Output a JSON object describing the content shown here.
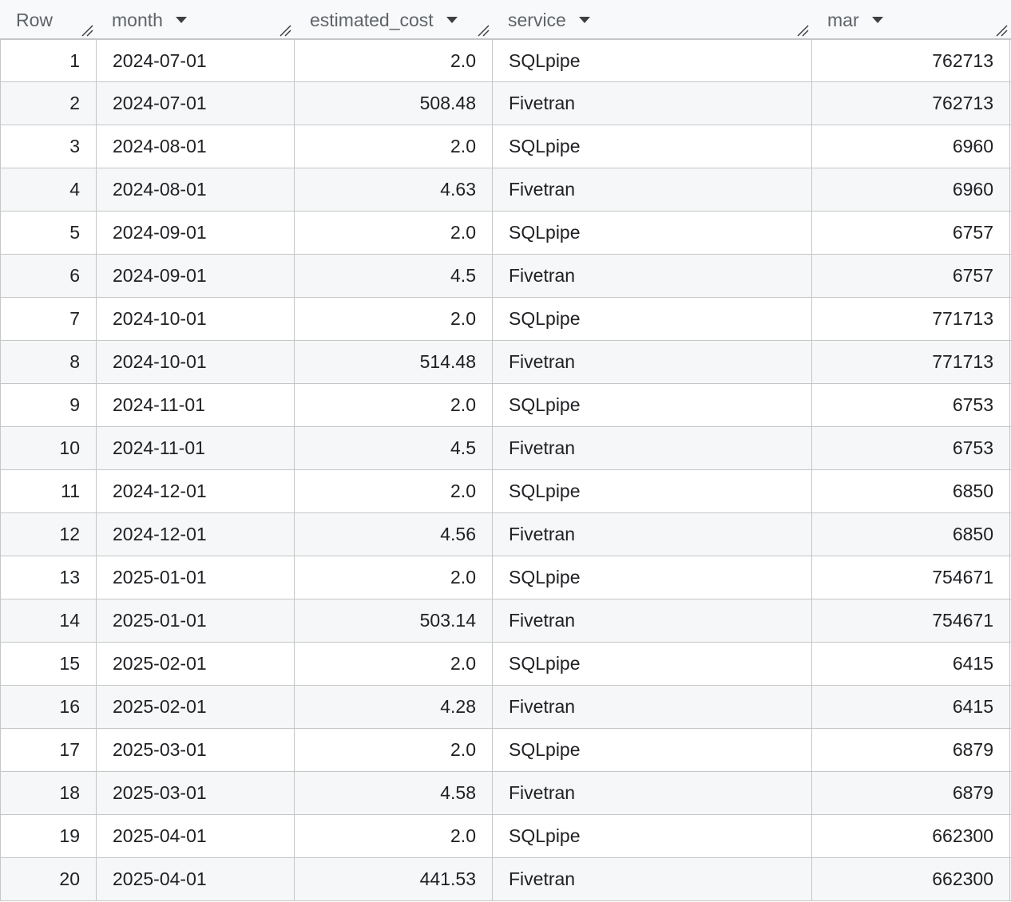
{
  "columns": [
    {
      "label": "Row",
      "has_menu": false
    },
    {
      "label": "month",
      "has_menu": true
    },
    {
      "label": "estimated_cost",
      "has_menu": true
    },
    {
      "label": "service",
      "has_menu": true
    },
    {
      "label": "mar",
      "has_menu": true
    }
  ],
  "rows": [
    {
      "row": "1",
      "month": "2024-07-01",
      "estimated_cost": "2.0",
      "service": "SQLpipe",
      "mar": "762713"
    },
    {
      "row": "2",
      "month": "2024-07-01",
      "estimated_cost": "508.48",
      "service": "Fivetran",
      "mar": "762713"
    },
    {
      "row": "3",
      "month": "2024-08-01",
      "estimated_cost": "2.0",
      "service": "SQLpipe",
      "mar": "6960"
    },
    {
      "row": "4",
      "month": "2024-08-01",
      "estimated_cost": "4.63",
      "service": "Fivetran",
      "mar": "6960"
    },
    {
      "row": "5",
      "month": "2024-09-01",
      "estimated_cost": "2.0",
      "service": "SQLpipe",
      "mar": "6757"
    },
    {
      "row": "6",
      "month": "2024-09-01",
      "estimated_cost": "4.5",
      "service": "Fivetran",
      "mar": "6757"
    },
    {
      "row": "7",
      "month": "2024-10-01",
      "estimated_cost": "2.0",
      "service": "SQLpipe",
      "mar": "771713"
    },
    {
      "row": "8",
      "month": "2024-10-01",
      "estimated_cost": "514.48",
      "service": "Fivetran",
      "mar": "771713"
    },
    {
      "row": "9",
      "month": "2024-11-01",
      "estimated_cost": "2.0",
      "service": "SQLpipe",
      "mar": "6753"
    },
    {
      "row": "10",
      "month": "2024-11-01",
      "estimated_cost": "4.5",
      "service": "Fivetran",
      "mar": "6753"
    },
    {
      "row": "11",
      "month": "2024-12-01",
      "estimated_cost": "2.0",
      "service": "SQLpipe",
      "mar": "6850"
    },
    {
      "row": "12",
      "month": "2024-12-01",
      "estimated_cost": "4.56",
      "service": "Fivetran",
      "mar": "6850"
    },
    {
      "row": "13",
      "month": "2025-01-01",
      "estimated_cost": "2.0",
      "service": "SQLpipe",
      "mar": "754671"
    },
    {
      "row": "14",
      "month": "2025-01-01",
      "estimated_cost": "503.14",
      "service": "Fivetran",
      "mar": "754671"
    },
    {
      "row": "15",
      "month": "2025-02-01",
      "estimated_cost": "2.0",
      "service": "SQLpipe",
      "mar": "6415"
    },
    {
      "row": "16",
      "month": "2025-02-01",
      "estimated_cost": "4.28",
      "service": "Fivetran",
      "mar": "6415"
    },
    {
      "row": "17",
      "month": "2025-03-01",
      "estimated_cost": "2.0",
      "service": "SQLpipe",
      "mar": "6879"
    },
    {
      "row": "18",
      "month": "2025-03-01",
      "estimated_cost": "4.58",
      "service": "Fivetran",
      "mar": "6879"
    },
    {
      "row": "19",
      "month": "2025-04-01",
      "estimated_cost": "2.0",
      "service": "SQLpipe",
      "mar": "662300"
    },
    {
      "row": "20",
      "month": "2025-04-01",
      "estimated_cost": "441.53",
      "service": "Fivetran",
      "mar": "662300"
    }
  ],
  "colors": {
    "header_bg": "#f8f9fa",
    "alt_row_bg": "#f6f7f9",
    "border": "#c4c7c5",
    "text": "#202124",
    "header_text": "#5f6368"
  },
  "icons": {
    "sort_menu": "caret-down-icon",
    "column_resize": "resize-handle-icon"
  }
}
